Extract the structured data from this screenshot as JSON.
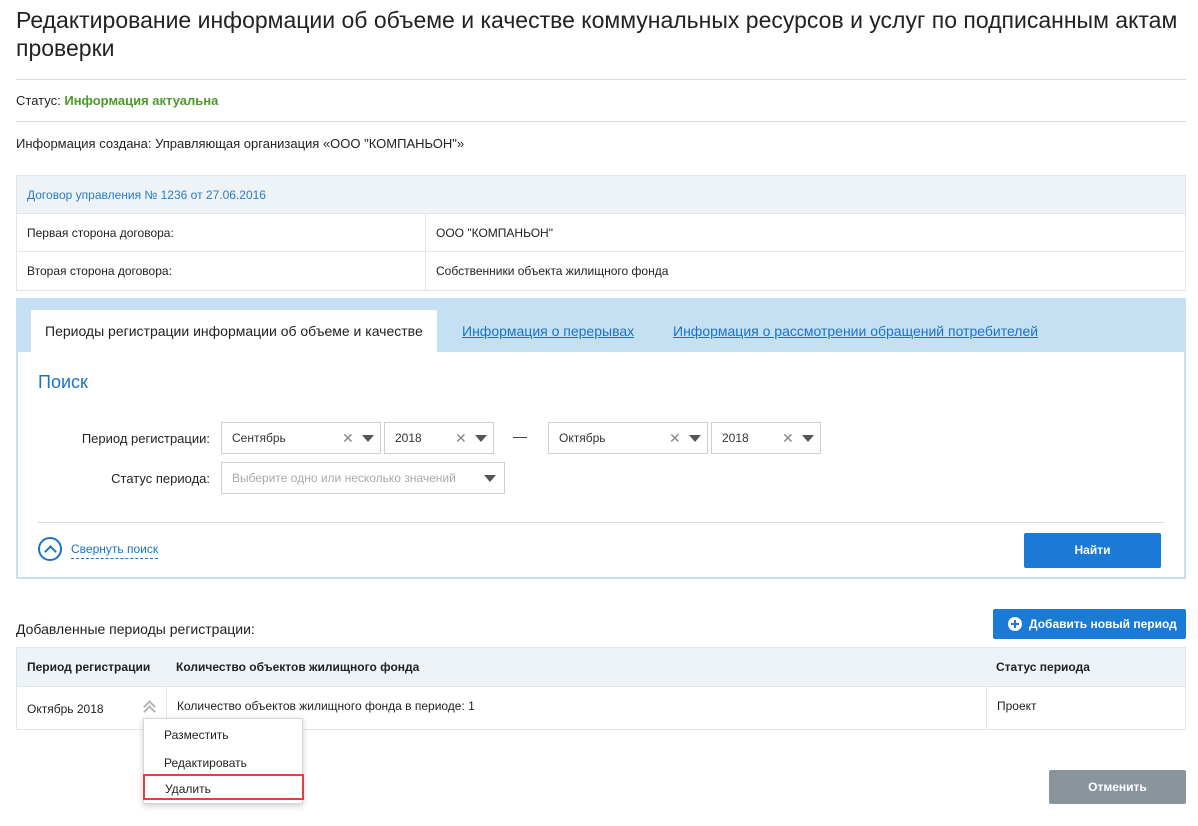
{
  "page": {
    "title": "Редактирование информации об объеме и качестве коммунальных ресурсов и услуг по подписанным актам проверки",
    "status_label": "Статус:",
    "status_value": "Информация актуальна",
    "created_label": "Информация создана:",
    "created_value": "Управляющая организация «ООО \"КОМПАНЬОН\"»"
  },
  "contract": {
    "title": "Договор управления № 1236 от 27.06.2016",
    "rows": [
      {
        "key": "Первая сторона договора:",
        "value": "ООО \"КОМПАНЬОН\""
      },
      {
        "key": "Вторая сторона договора:",
        "value": "Собственники объекта жилищного фонда"
      }
    ]
  },
  "tabs": [
    {
      "label": "Периоды регистрации информации об объеме и качестве",
      "active": true
    },
    {
      "label": "Информация о перерывах",
      "active": false
    },
    {
      "label": "Информация о рассмотрении обращений потребителей",
      "active": false
    }
  ],
  "search": {
    "title": "Поиск",
    "period_label": "Период регистрации:",
    "from_month": "Сентябрь",
    "from_year": "2018",
    "separator": "—",
    "to_month": "Октябрь",
    "to_year": "2018",
    "status_label": "Статус периода:",
    "status_placeholder": "Выберите одно или несколько значений",
    "collapse_label": "Свернуть поиск",
    "find_label": "Найти"
  },
  "periods": {
    "title": "Добавленные периоды регистрации:",
    "add_label": "Добавить новый период",
    "columns": [
      "Период регистрации",
      "Количество объектов жилищного фонда",
      "Статус периода"
    ],
    "rows": [
      {
        "period": "Октябрь 2018",
        "count": "Количество объектов жилищного фонда в периоде: 1",
        "status": "Проект"
      }
    ]
  },
  "context_menu": {
    "items": [
      "Разместить",
      "Редактировать",
      "Удалить"
    ]
  },
  "footer": {
    "cancel_label": "Отменить"
  },
  "colors": {
    "accent": "#1a7ad6",
    "link": "#1a73c7",
    "status_ok": "#4d9a2a",
    "tabs_bg": "#c6e0f3",
    "highlight": "#e04040",
    "cancel_bg": "#8a949b"
  }
}
